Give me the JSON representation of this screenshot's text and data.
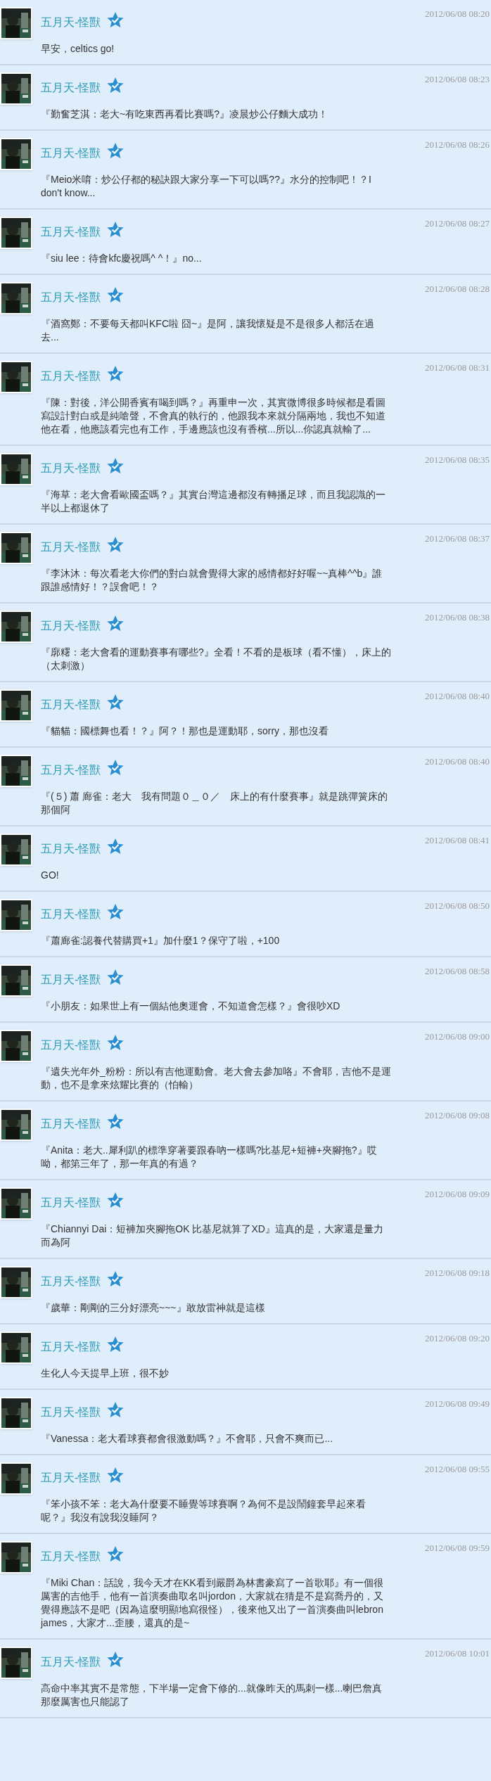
{
  "comments": [
    {
      "author": "五月天-怪獸",
      "time": "2012/06/08 08:20",
      "text": "早安，celtics go!"
    },
    {
      "author": "五月天-怪獸",
      "time": "2012/06/08 08:23",
      "text": "『勤奮芝淇：老大~有吃東西再看比賽嗎?』凌晨炒公仔麵大成功！"
    },
    {
      "author": "五月天-怪獸",
      "time": "2012/06/08 08:26",
      "text": "『Meio米唷：炒公仔都的秘訣跟大家分享一下可以嗎??』水分的控制吧！？I don't know..."
    },
    {
      "author": "五月天-怪獸",
      "time": "2012/06/08 08:27",
      "text": "『siu lee：待會kfc慶祝嗎^ ^！』no..."
    },
    {
      "author": "五月天-怪獸",
      "time": "2012/06/08 08:28",
      "text": "『酒窩鄭：不要每天都叫KFC啦 囧~』是阿，讓我懷疑是不是很多人都活在過去..."
    },
    {
      "author": "五月天-怪獸",
      "time": "2012/06/08 08:31",
      "text": "『陳：對後，洋公開香賓有喝到嗎？』再重申一次，其實微博很多時候都是看圖寫設計對白或是純嗆聲，不會真的執行的，他跟我本來就分隔兩地，我也不知道他在看，他應該看完也有工作，手邊應該也沒有香檳...所以...你認真就輸了..."
    },
    {
      "author": "五月天-怪獸",
      "time": "2012/06/08 08:35",
      "text": "『海草：老大會看歐國盃嗎？』其實台灣這邊都沒有轉播足球，而且我認識的一半以上都退休了"
    },
    {
      "author": "五月天-怪獸",
      "time": "2012/06/08 08:37",
      "text": "『李沐沐：每次看老大你們的對白就會覺得大家的感情都好好喔~~真棒^^b』誰跟誰感情好！？誤會吧！？"
    },
    {
      "author": "五月天-怪獸",
      "time": "2012/06/08 08:38",
      "text": "『廓糬：老大會看的運動賽事有哪些?』全看！不看的是板球（看不懂），床上的（太刺激）"
    },
    {
      "author": "五月天-怪獸",
      "time": "2012/06/08 08:40",
      "text": "『貓貓：國標舞也看！？』阿？！那也是運動耶，sorry，那也沒看"
    },
    {
      "author": "五月天-怪獸",
      "time": "2012/06/08 08:40",
      "text": "『(５) 蕭 廊雀：老大　我有問題０＿０／　床上的有什麼賽事』就是跳彈簧床的那個阿"
    },
    {
      "author": "五月天-怪獸",
      "time": "2012/06/08 08:41",
      "text": "GO!"
    },
    {
      "author": "五月天-怪獸",
      "time": "2012/06/08 08:50",
      "text": "『蕭廊雀:認養代替購買+1』加什麼1？保守了啦，+100"
    },
    {
      "author": "五月天-怪獸",
      "time": "2012/06/08 08:58",
      "text": "『小朋友：如果世上有一個結他奧運會，不知道會怎樣？』會很吵XD"
    },
    {
      "author": "五月天-怪獸",
      "time": "2012/06/08 09:00",
      "text": "『遺失光年外_粉粉：所以有吉他運動會。老大會去參加咯』不會耶，吉他不是運動，也不是拿來炫耀比賽的（怕輸）"
    },
    {
      "author": "五月天-怪獸",
      "time": "2012/06/08 09:08",
      "text": "『Anita：老大..犀利趴的標準穿著要跟春吶一樣嗎?比基尼+短褲+夾腳拖?』哎呦，都第三年了，那一年真的有過？"
    },
    {
      "author": "五月天-怪獸",
      "time": "2012/06/08 09:09",
      "text": "『Chiannyi Dai：短褲加夾腳拖OK 比基尼就算了XD』這真的是，大家還是量力而為阿"
    },
    {
      "author": "五月天-怪獸",
      "time": "2012/06/08 09:18",
      "text": "『歲華：剛剛的三分好漂亮~~~』敢放雷神就是這樣"
    },
    {
      "author": "五月天-怪獸",
      "time": "2012/06/08 09:20",
      "text": "生化人今天提早上班，很不妙"
    },
    {
      "author": "五月天-怪獸",
      "time": "2012/06/08 09:49",
      "text": "『Vanessa：老大看球賽都會很激動嗎？』不會耶，只會不爽而已..."
    },
    {
      "author": "五月天-怪獸",
      "time": "2012/06/08 09:55",
      "text": "『笨小孩不笨：老大為什麼要不睡覺等球賽啊？為何不是設鬧鐘套早起來看呢？』我沒有說我沒睡阿？"
    },
    {
      "author": "五月天-怪獸",
      "time": "2012/06/08 09:59",
      "text": "『Miki Chan：話說，我今天才在KK看到嚴爵為林書豪寫了一首歌耶』有一個很厲害的吉他手，他有一首演奏曲取名叫jordon，大家就在猜是不是寫喬丹的，又覺得應該不是吧（因為這麼明顯地寫很怪），後來他又出了一首演奏曲叫lebron james，大家才...歪腰，還真的是~"
    },
    {
      "author": "五月天-怪獸",
      "time": "2012/06/08 10:01",
      "text": "高命中率其實不是常態，下半場一定會下修的...就像昨天的馬刺一樣...喇巴詹真那麼厲害也只能認了"
    }
  ]
}
